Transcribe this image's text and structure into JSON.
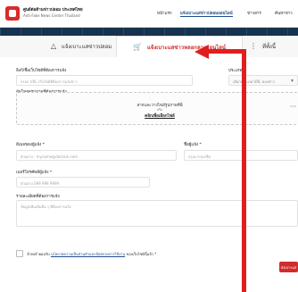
{
  "header": {
    "brand_th": "ศูนย์ต่อต้านข่าวปลอม ประเทศไทย",
    "brand_en": "Anti-Fake News Center Thailand",
    "nav": [
      "หน้าแรก",
      "แจ้งเบาะแสข่าวปลอมออนไลน์",
      "ข่าวสาร",
      "ค้นหาข่าว"
    ]
  },
  "tabs": [
    {
      "label": "แจ้งเบาะแสข่าวปลอม",
      "icon": "bell-icon"
    },
    {
      "label": "แจ้งเบาะแสข่าวหลอกลวงออนไลน์",
      "icon": "cart-icon"
    },
    {
      "label": "ที่ทั้งนี้",
      "icon": "more-icon"
    }
  ],
  "form": {
    "url_label": "ลิงก์/ชื่อเว็บไซต์ที่ต้องการแจ้ง",
    "url_placeholder": "กรอก URL เว็บไซต์ที่ต้องการแจ้งข่าว",
    "type_label": "ประเภท *",
    "type_value": "เลือกประเภท URL ของข่าว",
    "upload_label": "อัพโหลดรูปภาพที่ต้องการแจ้ง",
    "upload_text": "ลากและวางไฟล์รูปภาพที่นี่",
    "upload_or": "หรือ",
    "upload_link": "คลิกเพื่อเลือกไฟล์",
    "upload_hint": "0/10",
    "email_label": "อีเมลของผู้แจ้ง *",
    "email_placeholder": "ตัวอย่าง : myname@domain.com",
    "name_label": "ชื่อผู้แจ้ง *",
    "name_placeholder": "กรุณากรอกชื่อ",
    "phone_label": "เบอร์โทรศัพท์ผู้แจ้ง *",
    "phone_placeholder": "ตัวอย่าง 099 999 9999",
    "detail_label": "รายละเอียดที่ต้องการแจ้ง",
    "detail_placeholder": "ข้อมูลเพิ่มเติมอื่น ๆ ที่ต้องการแจ้ง",
    "consent_prefix": "ข้าพเจ้ายอมรับ",
    "consent_link": "นโยบายความเป็นส่วนตัวและข้อตกลงการใช้งาน",
    "consent_suffix": " ของเว็บไซต์นี้แล้ว *",
    "submit": "ส่งเบาะแส"
  },
  "colors": {
    "accent": "#d12c2c",
    "link": "#1f4e8c",
    "annotation": "#e01f1f"
  }
}
